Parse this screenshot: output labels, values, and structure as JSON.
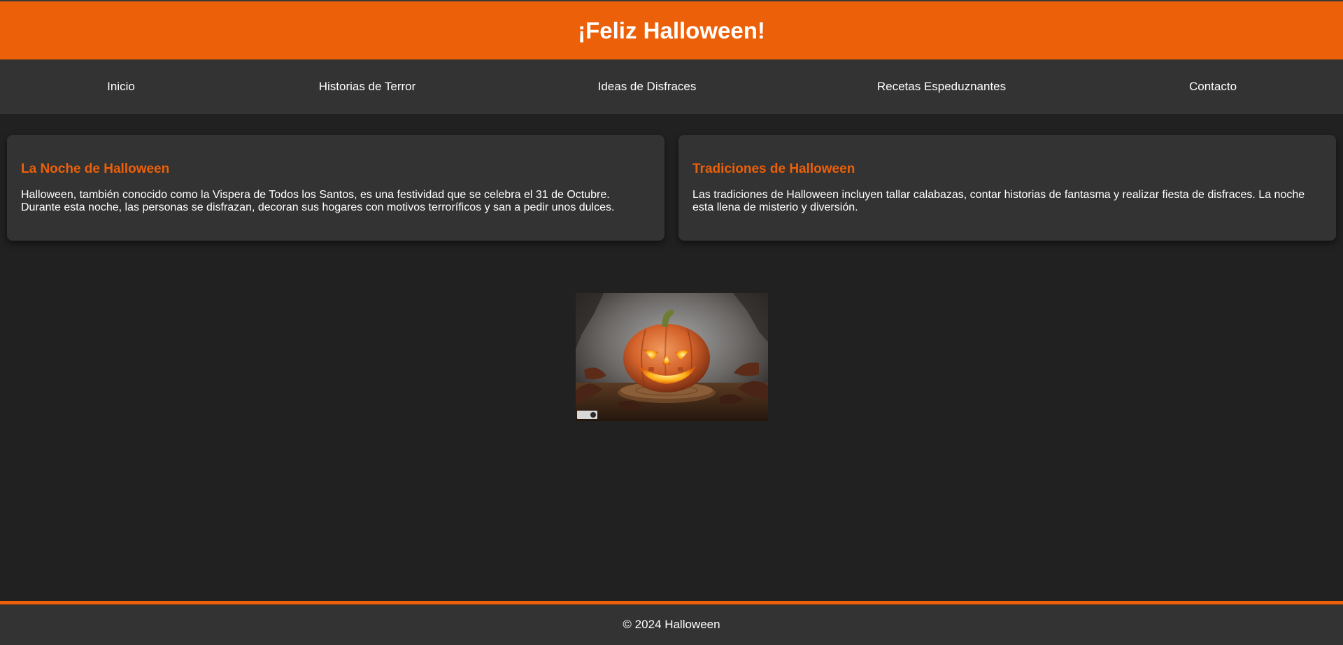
{
  "header": {
    "title": "¡Feliz Halloween!"
  },
  "nav": {
    "items": [
      {
        "label": "Inicio"
      },
      {
        "label": "Historias de Terror"
      },
      {
        "label": "Ideas de Disfraces"
      },
      {
        "label": "Recetas Espeduznantes"
      },
      {
        "label": "Contacto"
      }
    ]
  },
  "main": {
    "cards": [
      {
        "title": "La Noche de Halloween",
        "text": "Halloween, también conocido como la Vispera de Todos los Santos, es una festividad que se celebra el 31 de Octubre. Durante esta noche, las personas se disfrazan, decoran sus hogares con motivos terroríficos y san a pedir unos dulces."
      },
      {
        "title": "Tradiciones de Halloween",
        "text": "Las tradiciones de Halloween incluyen tallar calabazas, contar historias de fantasma y realizar fiesta de disfraces. La noche esta llena de misterio y diversión."
      }
    ],
    "image": {
      "subject": "jack-o-lantern-pumpkin"
    }
  },
  "footer": {
    "text": "© 2024 Halloween"
  },
  "colors": {
    "accent": "#ec6009",
    "background": "#212121",
    "panel": "#333333",
    "text": "#ffffff"
  }
}
